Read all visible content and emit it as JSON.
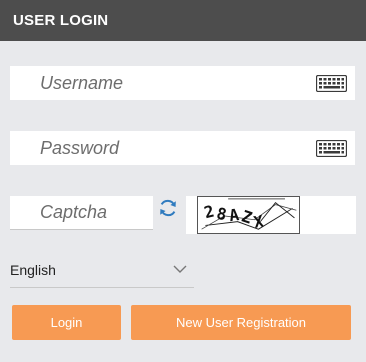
{
  "header": {
    "title": "USER LOGIN"
  },
  "username": {
    "placeholder": "Username",
    "value": ""
  },
  "password": {
    "placeholder": "Password",
    "value": ""
  },
  "captcha": {
    "placeholder": "Captcha",
    "value": "",
    "image_text": "28AZX"
  },
  "language": {
    "selected": "English"
  },
  "buttons": {
    "login": "Login",
    "register": "New User Registration"
  },
  "colors": {
    "header_bg": "#4d4d4d",
    "page_bg": "#e8e9ec",
    "button_bg": "#f79a53",
    "refresh_icon": "#2f7bbf"
  },
  "icons": {
    "keyboard": "keyboard-icon",
    "refresh": "refresh-icon",
    "dropdown": "chevron-down-icon"
  }
}
